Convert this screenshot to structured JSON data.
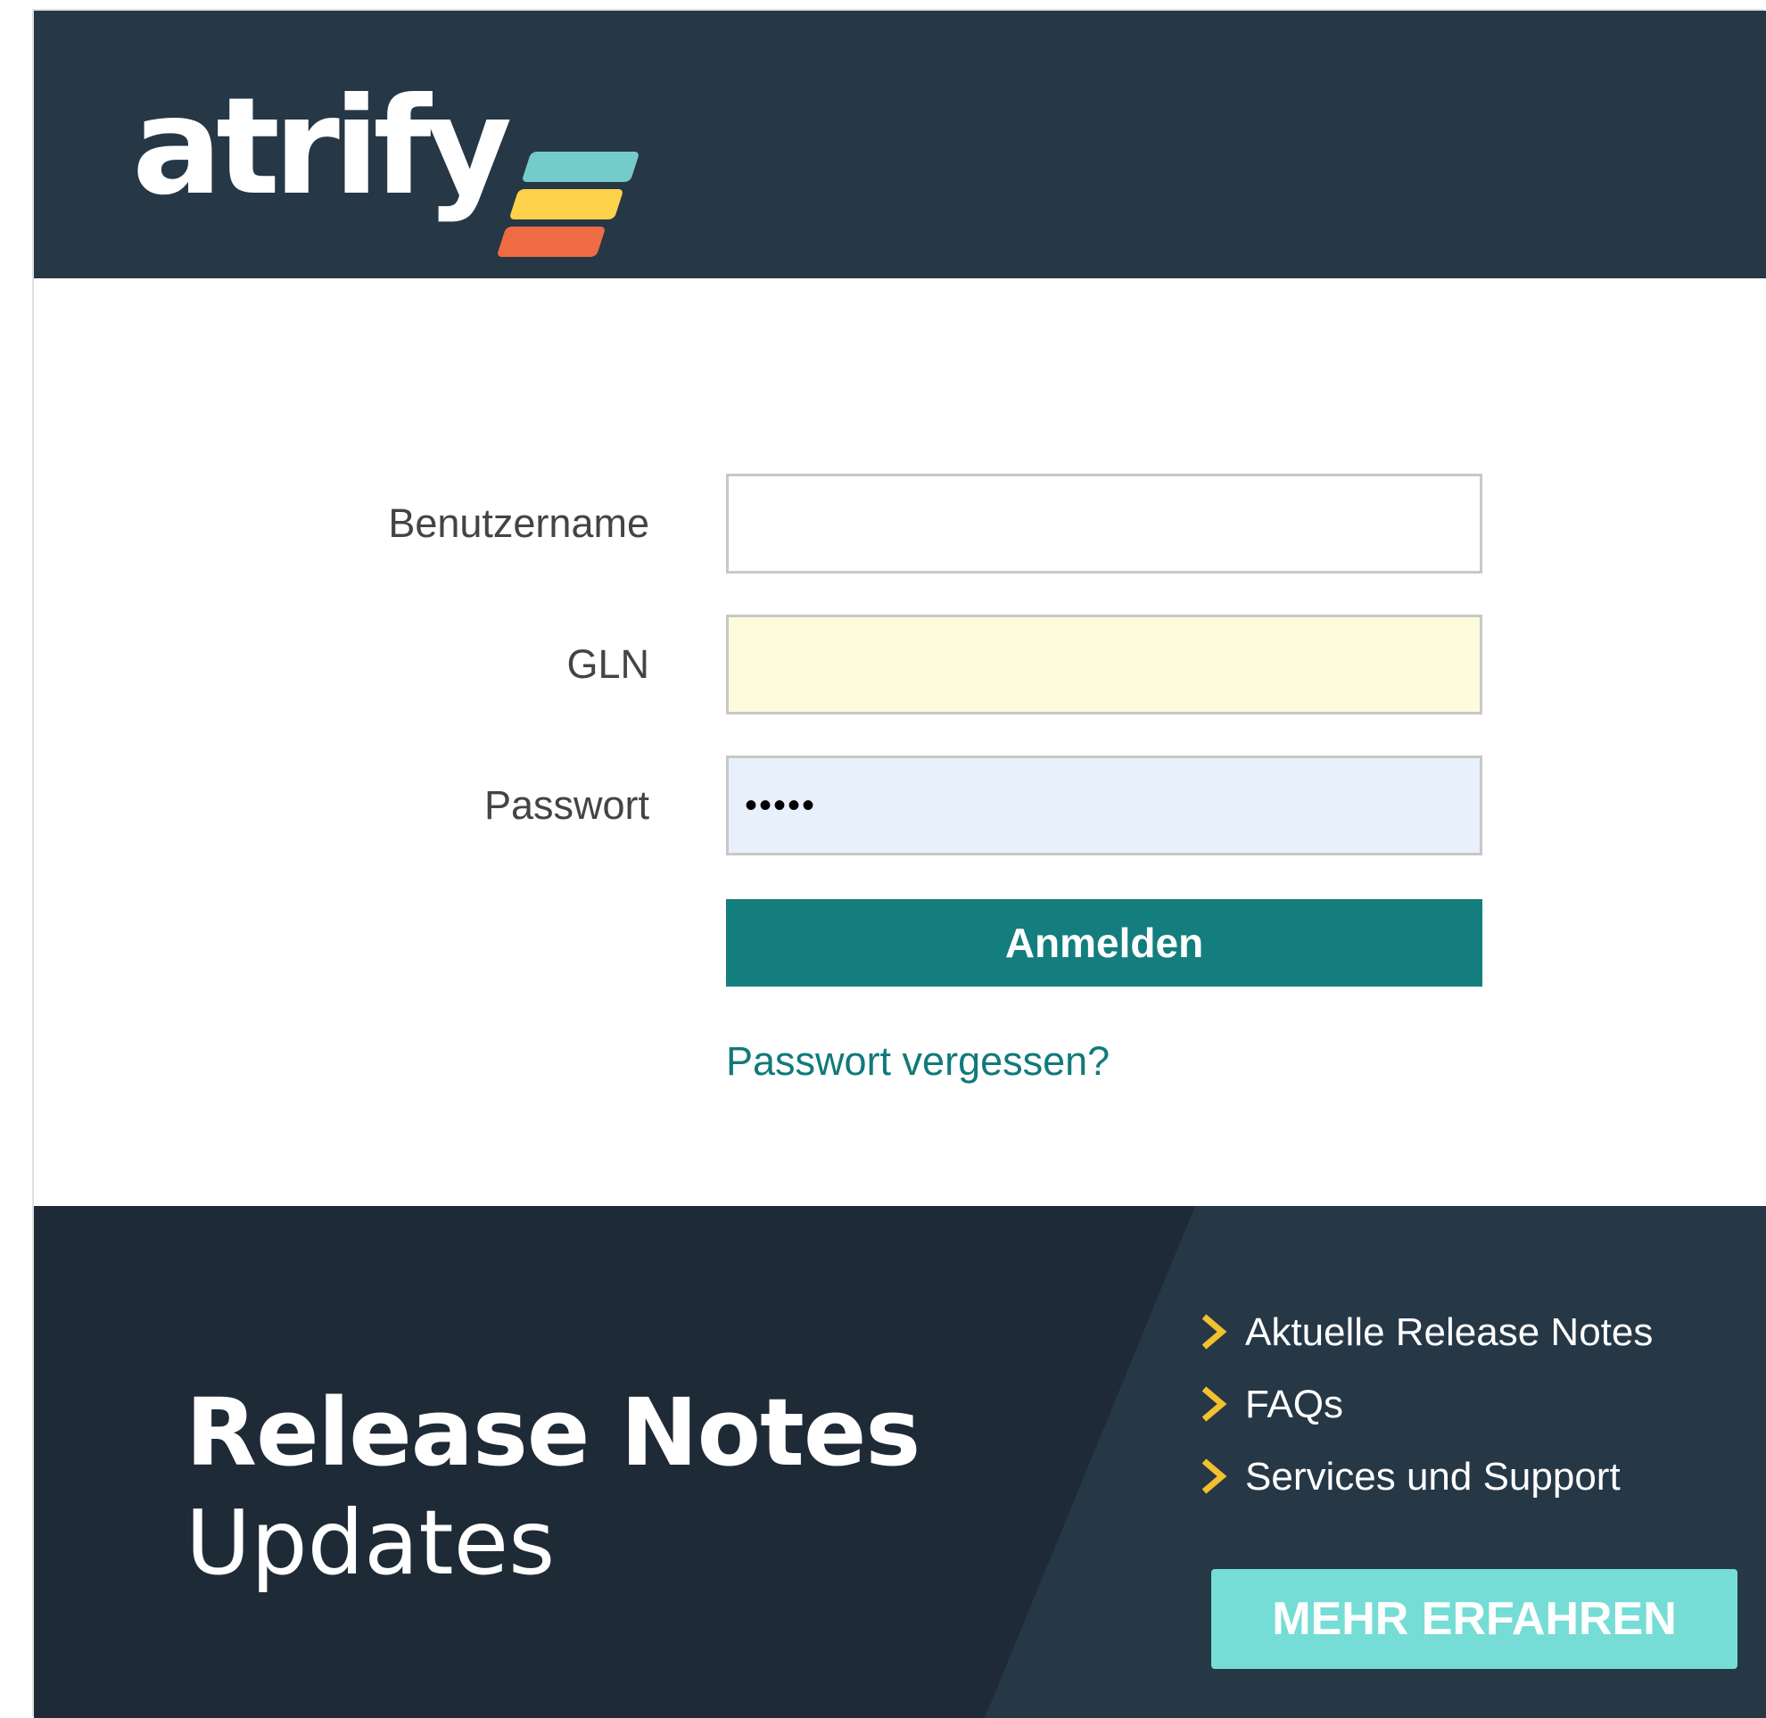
{
  "brand": {
    "logo_text": "atrify",
    "stripe_colors": [
      "#74cbc9",
      "#fdd24a",
      "#ef6b44"
    ]
  },
  "login": {
    "username_label": "Benutzername",
    "username_value": "",
    "gln_label": "GLN",
    "gln_value": "",
    "password_label": "Passwort",
    "password_value": "•••••",
    "submit_label": "Anmelden",
    "forgot_link": "Passwort vergessen?"
  },
  "banner": {
    "title": "Release Notes",
    "subtitle": "Updates",
    "links": [
      "Aktuelle Release Notes",
      "FAQs",
      "Services und Support"
    ],
    "cta_label": "MEHR ERFAHREN",
    "chevron_color": "#f2c12e"
  }
}
